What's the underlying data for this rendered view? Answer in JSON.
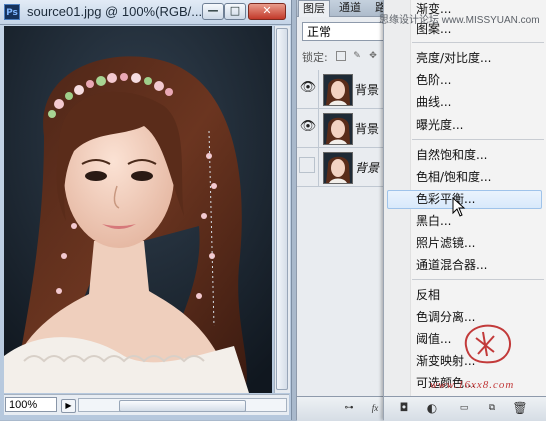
{
  "document": {
    "title": "source01.jpg @ 100%(RGB/...",
    "zoom": "100%",
    "buttons": {
      "minimize": "—",
      "maximize": "□",
      "close": "✕"
    }
  },
  "layers_panel": {
    "tabs": [
      "图层",
      "通道",
      "路"
    ],
    "blend_mode": "正常",
    "lock_label": "锁定:",
    "layers": [
      {
        "name": "背景 副",
        "visible": true
      },
      {
        "name": "背景 副",
        "visible": true
      },
      {
        "name": "背景",
        "visible": false
      }
    ]
  },
  "menu": {
    "items_group1": [
      "渐变...",
      "图案..."
    ],
    "items_group2": [
      "亮度/对比度...",
      "色阶...",
      "曲线...",
      "曝光度..."
    ],
    "items_group3": [
      "自然饱和度...",
      "色相/饱和度...",
      "色彩平衡...",
      "黑白...",
      "照片滤镜...",
      "通道混合器..."
    ],
    "items_group4": [
      "反相",
      "色调分离...",
      "阈值...",
      "渐变映射...",
      "可选颜色..."
    ],
    "hovered": "色彩平衡..."
  },
  "watermarks": {
    "top": "思缘设计论坛 www.MISSYUAN.com",
    "bottom": "www.16xx8.com"
  },
  "colors": {
    "accent": "#4a7fc1",
    "hover": "#d8e9fb",
    "close": "#c2392a"
  }
}
